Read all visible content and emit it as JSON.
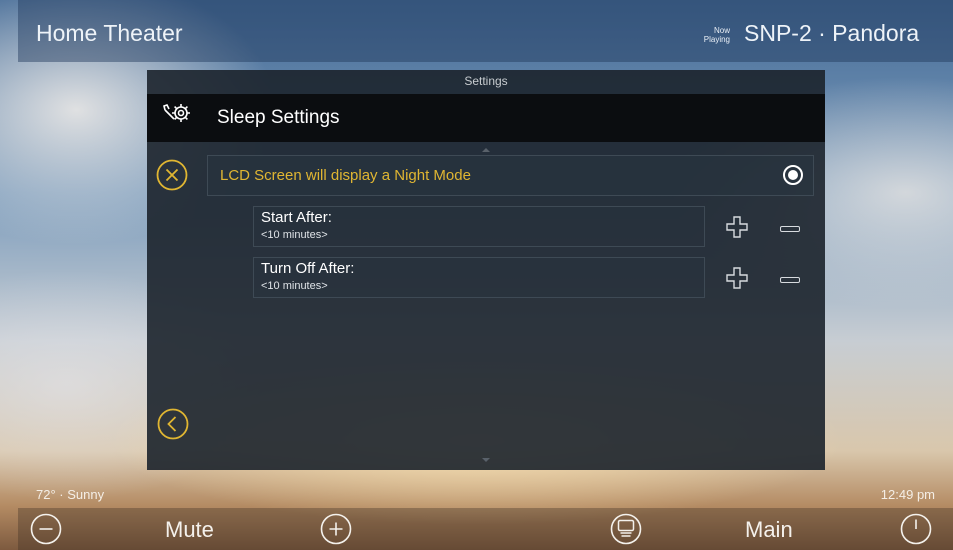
{
  "header": {
    "title": "Home Theater",
    "now_playing_label": "Now Playing",
    "source": "SNP-2 · Pandora"
  },
  "dialog": {
    "title": "Settings",
    "section_title": "Sleep Settings",
    "section_icon": "tools-icon",
    "night_mode_label": "LCD Screen will display a Night Mode",
    "night_mode_enabled": true,
    "start_after": {
      "label": "Start After:",
      "value": "<10 minutes>"
    },
    "turn_off_after": {
      "label": "Turn Off After:",
      "value": "<10 minutes>"
    }
  },
  "status": {
    "weather": "72° · Sunny",
    "time": "12:49 pm"
  },
  "bottom_bar": {
    "mute_label": "Mute",
    "main_label": "Main",
    "icons": [
      "volume-down-icon",
      "volume-up-icon",
      "remote-icon",
      "power-icon"
    ]
  },
  "colors": {
    "accent": "#e0b632",
    "dialog_bg": "#1c242c",
    "header_bg": "#0b0d10"
  }
}
